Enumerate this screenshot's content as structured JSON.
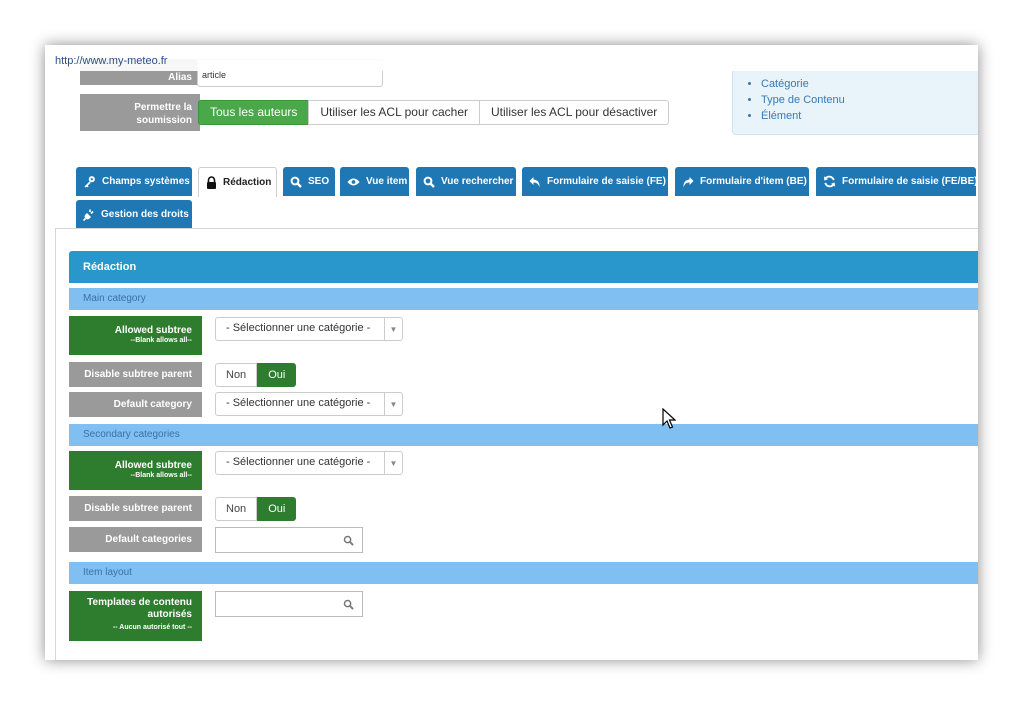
{
  "browser": {
    "url": "http://www.my-meteo.fr"
  },
  "top": {
    "alias": {
      "label": "Alias",
      "value": "article"
    },
    "permission": {
      "label": "Permettre la soumission",
      "options": [
        "Tous les auteurs",
        "Utiliser les ACL pour cacher",
        "Utiliser les ACL pour désactiver"
      ],
      "selected": "Tous les auteurs"
    },
    "info_list": [
      "Catégorie",
      "Type de Contenu",
      "Élément"
    ]
  },
  "tabs": [
    {
      "label": "Champs systèmes",
      "icon": "key-icon",
      "active": false
    },
    {
      "label": "Rédaction",
      "icon": "lock-icon",
      "active": true
    },
    {
      "label": "SEO",
      "icon": "search-icon",
      "active": false
    },
    {
      "label": "Vue item",
      "icon": "eye-icon",
      "active": false
    },
    {
      "label": "Vue rechercher",
      "icon": "search-icon",
      "active": false
    },
    {
      "label": "Formulaire de saisie (FE)",
      "icon": "reply-arrow-icon",
      "active": false
    },
    {
      "label": "Formulaire d'item (BE)",
      "icon": "share-arrow-icon",
      "active": false
    },
    {
      "label": "Formulaire de saisie (FE/BE)",
      "icon": "refresh-icon",
      "active": false
    },
    {
      "label": "Gestion des droits",
      "icon": "plug-icon",
      "active": false
    }
  ],
  "panel": {
    "title": "Rédaction",
    "sections": {
      "main": "Main category",
      "secondary": "Secondary categories",
      "layout": "Item layout"
    },
    "rows": {
      "main_allowed": {
        "label": "Allowed subtree",
        "hint": "--Blank allows all--",
        "value": "- Sélectionner une catégorie -"
      },
      "main_disable": {
        "label": "Disable subtree parent",
        "options": [
          "Non",
          "Oui"
        ],
        "selected": "Oui"
      },
      "main_default": {
        "label": "Default category",
        "value": "- Sélectionner une catégorie -"
      },
      "sec_allowed": {
        "label": "Allowed subtree",
        "hint": "--Blank allows all--",
        "value": "- Sélectionner une catégorie -"
      },
      "sec_disable": {
        "label": "Disable subtree parent",
        "options": [
          "Non",
          "Oui"
        ],
        "selected": "Oui"
      },
      "sec_default": {
        "label": "Default categories",
        "value": ""
      },
      "templates": {
        "label": "Templates de contenu autorisés",
        "hint": "-- Aucun autorisé tout --",
        "value": ""
      }
    }
  },
  "colors": {
    "tab": "#1f77b4",
    "panel_head": "#2996cc",
    "section": "#80bff2",
    "green": "#2e7d2e",
    "gray_label": "#9a9a9a"
  }
}
